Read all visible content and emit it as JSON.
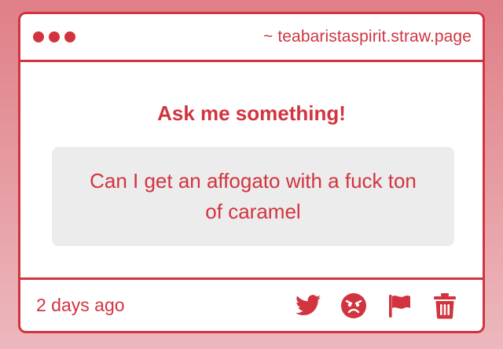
{
  "window": {
    "url": "~ teabaristaspirit.straw.page"
  },
  "main": {
    "heading": "Ask me something!",
    "question": "Can I get an affogato with a fuck ton of caramel"
  },
  "footer": {
    "timestamp": "2 days ago",
    "actions": [
      {
        "icon": "twitter-icon"
      },
      {
        "icon": "angry-face-icon"
      },
      {
        "icon": "flag-icon"
      },
      {
        "icon": "trash-icon"
      }
    ]
  },
  "colors": {
    "accent": "#d1343f",
    "box": "#ececec",
    "background_top": "#e07f87",
    "background_bottom": "#ecb8bd"
  }
}
